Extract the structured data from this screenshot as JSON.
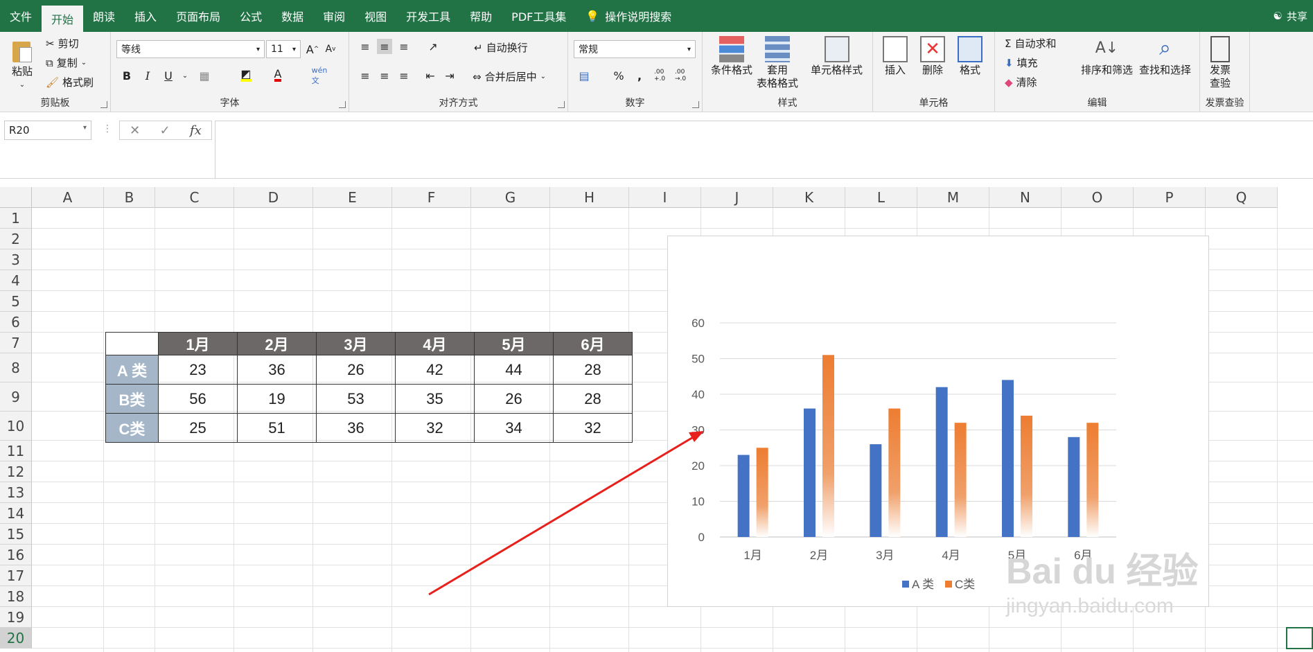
{
  "tabs": [
    "文件",
    "开始",
    "朗读",
    "插入",
    "页面布局",
    "公式",
    "数据",
    "审阅",
    "视图",
    "开发工具",
    "帮助",
    "PDF工具集"
  ],
  "active_tab": "开始",
  "search_label": "操作说明搜索",
  "share_label": "共享",
  "clipboard": {
    "paste": "粘贴",
    "cut": "剪切",
    "copy": "复制",
    "format_painter": "格式刷",
    "label": "剪贴板"
  },
  "font": {
    "name": "等线",
    "size": "11",
    "bold": "B",
    "italic": "I",
    "underline": "U",
    "label": "字体",
    "grow": "A",
    "shrink": "A",
    "wen": "wén 文"
  },
  "align": {
    "wrap": "自动换行",
    "merge": "合并后居中",
    "label": "对齐方式"
  },
  "number": {
    "format": "常规",
    "percent": "%",
    "comma": ",",
    "inc": ".00 +.0",
    "dec": ".00 →.0",
    "label": "数字"
  },
  "styles": {
    "cond": "条件格式",
    "table": "套用\n表格格式",
    "cell": "单元格样式",
    "label": "样式"
  },
  "cells": {
    "insert": "插入",
    "delete": "删除",
    "format": "格式",
    "label": "单元格"
  },
  "edit": {
    "autosum": "自动求和",
    "fill": "填充",
    "clear": "清除",
    "sort": "排序和筛选",
    "find": "查找和选择",
    "label": "编辑"
  },
  "invoice": {
    "btn": "发票\n查验",
    "label": "发票查验"
  },
  "namebox": "R20",
  "columns": [
    "A",
    "B",
    "C",
    "D",
    "E",
    "F",
    "G",
    "H",
    "I",
    "J",
    "K",
    "L",
    "M",
    "N",
    "O",
    "P",
    "Q"
  ],
  "rows": [
    "1",
    "2",
    "3",
    "4",
    "5",
    "6",
    "7",
    "8",
    "9",
    "10",
    "11",
    "12",
    "13",
    "14",
    "15",
    "16",
    "17",
    "18",
    "19",
    "20"
  ],
  "table": {
    "headers": [
      "1月",
      "2月",
      "3月",
      "4月",
      "5月",
      "6月"
    ],
    "rows": [
      {
        "label": "A 类",
        "values": [
          "23",
          "36",
          "26",
          "42",
          "44",
          "28"
        ]
      },
      {
        "label": "B类",
        "values": [
          "56",
          "19",
          "53",
          "35",
          "26",
          "28"
        ]
      },
      {
        "label": "C类",
        "values": [
          "25",
          "51",
          "36",
          "32",
          "34",
          "32"
        ]
      }
    ]
  },
  "chart_data": {
    "type": "bar",
    "categories": [
      "1月",
      "2月",
      "3月",
      "4月",
      "5月",
      "6月"
    ],
    "series": [
      {
        "name": "A 类",
        "values": [
          23,
          36,
          26,
          42,
          44,
          28
        ],
        "color": "#4472c4"
      },
      {
        "name": "C类",
        "values": [
          25,
          51,
          36,
          32,
          34,
          32
        ],
        "color": "#ed7d31"
      }
    ],
    "ylim": [
      0,
      60
    ],
    "yticks": [
      0,
      10,
      20,
      30,
      40,
      50,
      60
    ],
    "grid": true,
    "legend": "bottom",
    "c_fill": "gradient fading to white at base"
  },
  "watermark": {
    "brand": "Bai du 经验",
    "url": "jingyan.baidu.com"
  },
  "colors": {
    "ribbon_green": "#217346",
    "header_fill": "#6d6868",
    "label_fill": "#a6b6c9",
    "arrow": "#e8201c"
  }
}
